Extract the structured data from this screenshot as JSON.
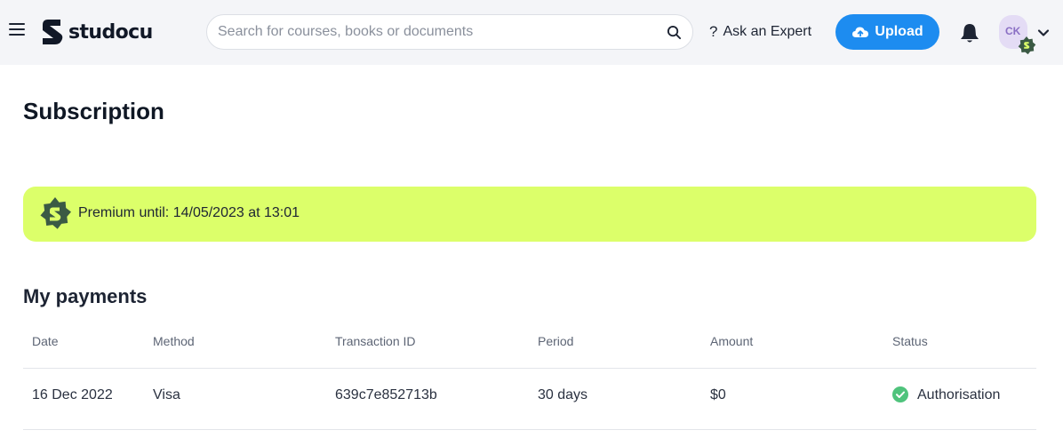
{
  "header": {
    "logo_text": "studocu",
    "search_placeholder": "Search for courses, books or documents",
    "ask_label": "Ask an Expert",
    "upload_label": "Upload",
    "avatar_initials": "CK"
  },
  "page": {
    "title": "Subscription",
    "premium_text": "Premium until: 14/05/2023 at 13:01",
    "payments_title": "My payments"
  },
  "payments_table": {
    "columns": [
      "Date",
      "Method",
      "Transaction ID",
      "Period",
      "Amount",
      "Status"
    ],
    "rows": [
      [
        "16 Dec 2022",
        "Visa",
        "639c7e852713b",
        "30 days",
        "$0",
        "Authorisation"
      ]
    ]
  },
  "icons": {
    "menu": "hamburger-menu-icon",
    "search": "search-icon",
    "ask": "question-mark-icon",
    "upload": "cloud-upload-icon",
    "bell": "bell-icon",
    "caret": "chevron-down-icon",
    "premium": "premium-badge-icon",
    "status": "check-circle-icon"
  },
  "colors": {
    "accent": "#1d8cf0",
    "premium_banner": "#dcff6a",
    "status_success": "#4fc37c",
    "badge_dark": "#3b5a44"
  }
}
